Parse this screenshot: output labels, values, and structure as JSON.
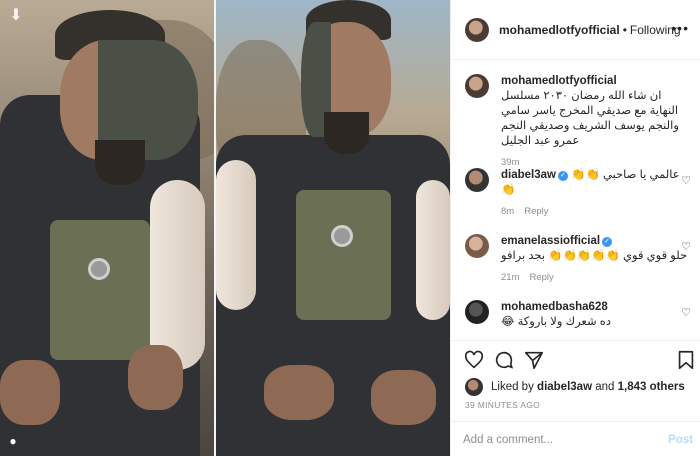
{
  "post": {
    "username": "mohamedlotfyofficial",
    "following_label": "Following",
    "caption": "ان شاء الله رمضان ٢٠٣٠ مسلسل النهاية مع صديقي المخرج ياسر سامي والنجم يوسف الشريف وصديقي النجم عمرو عبد الجليل",
    "caption_time": "39m"
  },
  "comments": [
    {
      "username": "diabel3aw",
      "verified": true,
      "text": "عالمي يا صاحبي 👏👏👏",
      "time": "8m",
      "reply": "Reply"
    },
    {
      "username": "emanelassiofficial",
      "verified": true,
      "text": "حلو قوي قوي 👏👏👏👏👏 بجد برافو",
      "time": "21m",
      "reply": "Reply"
    },
    {
      "username": "mohamedbasha628",
      "verified": false,
      "text": "ده شعرك ولا باروكة 😂",
      "time": "",
      "reply": ""
    }
  ],
  "likes": {
    "text_prefix": "Liked by",
    "liker": "diabel3aw",
    "text_mid": "and",
    "count": "1,843 others"
  },
  "timestamp": "39 MINUTES AGO",
  "add_comment": {
    "placeholder": "Add a comment...",
    "post_label": "Post"
  },
  "icons": {
    "download": "download-icon",
    "person": "person-tag-icon",
    "more": "more-options-icon",
    "heart": "heart-icon",
    "comment": "comment-icon",
    "share": "share-icon",
    "save": "bookmark-icon"
  },
  "colors": {
    "link_blue": "#3897f0",
    "post_disabled": "#b2dffc",
    "text": "#262626",
    "meta": "#8e8e8e"
  }
}
